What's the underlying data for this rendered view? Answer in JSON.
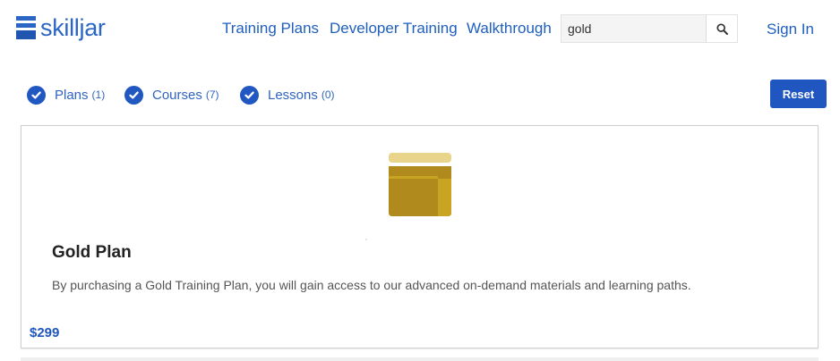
{
  "header": {
    "logo_text": "skilljar",
    "nav": {
      "training_plans": "Training Plans",
      "developer_training": "Developer Training",
      "walkthrough": "Walkthrough"
    },
    "search": {
      "value": "gold"
    },
    "sign_in": "Sign In"
  },
  "filters": [
    {
      "label": "Plans",
      "count": "(1)",
      "checked": true
    },
    {
      "label": "Courses",
      "count": "(7)",
      "checked": true
    },
    {
      "label": "Lessons",
      "count": "(0)",
      "checked": true
    }
  ],
  "reset_label": "Reset",
  "card": {
    "title": "Gold Plan",
    "description": "By purchasing a Gold Training Plan, you will gain access to our advanced on-demand materials and learning paths.",
    "price": "$299",
    "icon": "gold-plan-icon"
  },
  "colors": {
    "brand_blue": "#1f56bf",
    "gold_light": "#e8d48a",
    "gold_dark": "#b08a1c"
  }
}
